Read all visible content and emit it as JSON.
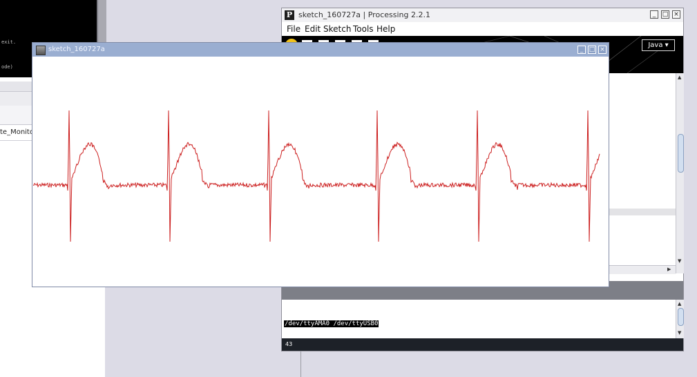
{
  "background_terminal": {
    "line1": "exit.",
    "line2": "ode)"
  },
  "background_window": {
    "file_label": "te_Monito"
  },
  "ide": {
    "title": "sketch_160727a | Processing 2.2.1",
    "menu": [
      "File",
      "Edit",
      "Sketch",
      "Tools",
      "Help"
    ],
    "mode": "Java",
    "console_text": "/dev/ttyAMA0 /dev/ttyUSB0",
    "line_number": "43",
    "window_buttons": [
      "_",
      "□",
      "×"
    ]
  },
  "sketch_window": {
    "title": "sketch_160727a",
    "window_buttons": [
      "_",
      "□",
      "×"
    ]
  },
  "colors": {
    "waveform": "#cc1f1f",
    "title_active": "#9aaed1",
    "toolbar": "#000000",
    "run_button": "#f1c21a"
  }
}
